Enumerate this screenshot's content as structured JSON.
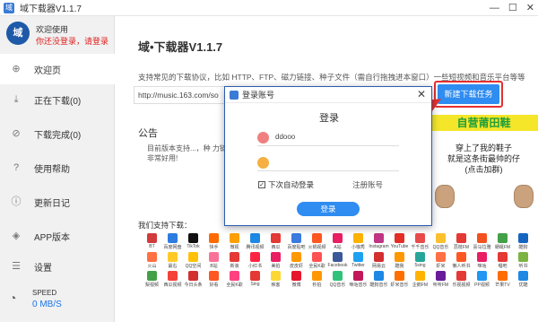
{
  "window": {
    "title": "域下载器V1.1.7",
    "min": "—",
    "max": "☐",
    "close": "✕"
  },
  "user": {
    "avatar_text": "域",
    "name": "欢迎使用",
    "login_tip": "你还没登录，请登录"
  },
  "sidebar": {
    "items": [
      {
        "label": "欢迎页",
        "icon": "plus-circle-icon"
      },
      {
        "label": "正在下载(0)",
        "icon": "download-icon"
      },
      {
        "label": "下载完成(0)",
        "icon": "check-circle-icon"
      },
      {
        "label": "使用帮助",
        "icon": "help-icon"
      },
      {
        "label": "更新日记",
        "icon": "info-icon"
      },
      {
        "label": "APP版本",
        "icon": "cube-icon"
      },
      {
        "label": "设置",
        "icon": "settings-icon"
      }
    ],
    "speed": {
      "label": "SPEED",
      "value": "0 MB/S"
    }
  },
  "main": {
    "title": "域•下载器V1.1.7",
    "subtitle": "支持常见的下载协议，比如 HTTP、FTP、磁力链接、种子文件（需自行拖拽进本窗口）一些短视频和音乐平台等等",
    "url_value": "http://music.163.com/so",
    "new_task_label": "新建下载任务",
    "notice_title": "公告",
    "notice_text": "目前版本支持...，种\n力链。非常好用!",
    "support_title": "我们支持下载："
  },
  "ad": {
    "banner": "自营莆田鞋",
    "line1": "穿上了我的鞋子",
    "line2": "就是这条街最帅的仔",
    "line3": "(点击加群)"
  },
  "apps": [
    {
      "name": "BT",
      "color": "#d23b3b"
    },
    {
      "name": "百度网盘",
      "color": "#2d7de0"
    },
    {
      "name": "TikTok",
      "color": "#111111"
    },
    {
      "name": "快手",
      "color": "#ff6a00"
    },
    {
      "name": "微视",
      "color": "#ff9f00"
    },
    {
      "name": "腾讯视频",
      "color": "#1e88e5"
    },
    {
      "name": "西瓜",
      "color": "#e53935"
    },
    {
      "name": "百度贴吧",
      "color": "#3b7be0"
    },
    {
      "name": "火锅视频",
      "color": "#ff5722"
    },
    {
      "name": "A站",
      "color": "#e91e63"
    },
    {
      "name": "小咖秀",
      "color": "#ffb300"
    },
    {
      "name": "Instagram",
      "color": "#c13584"
    },
    {
      "name": "YouTube",
      "color": "#e52d27"
    },
    {
      "name": "千千音乐",
      "color": "#e94b4b"
    },
    {
      "name": "QQ音乐",
      "color": "#fbc02d"
    },
    {
      "name": "荔枝FM",
      "color": "#e53935"
    },
    {
      "name": "喜马拉雅",
      "color": "#f4511e"
    },
    {
      "name": "蜻蜓FM",
      "color": "#43a047"
    },
    {
      "name": "酷狗",
      "color": "#1565c0"
    },
    {
      "name": "火山",
      "color": "#ff7043"
    },
    {
      "name": "最右",
      "color": "#ffca28"
    },
    {
      "name": "QQ空间",
      "color": "#ffc107"
    },
    {
      "name": "B站",
      "color": "#fb7299"
    },
    {
      "name": "新浪",
      "color": "#e53935"
    },
    {
      "name": "小红书",
      "color": "#ff2442"
    },
    {
      "name": "美拍",
      "color": "#e91e63"
    },
    {
      "name": "皮皮虾",
      "color": "#ff9800"
    },
    {
      "name": "全民K歌",
      "color": "#ff5252"
    },
    {
      "name": "Facebook",
      "color": "#3b5998"
    },
    {
      "name": "Twitter",
      "color": "#1da1f2"
    },
    {
      "name": "网易云",
      "color": "#d32f2f"
    },
    {
      "name": "酷我",
      "color": "#ff9800"
    },
    {
      "name": "5sing",
      "color": "#26a69a"
    },
    {
      "name": "虾米",
      "color": "#ff7043"
    },
    {
      "name": "懒人听书",
      "color": "#ff5722"
    },
    {
      "name": "咪咕",
      "color": "#e91e63"
    },
    {
      "name": "唱吧",
      "color": "#e53935"
    },
    {
      "name": "听书",
      "color": "#7cb342"
    },
    {
      "name": "梨视频",
      "color": "#43a047"
    },
    {
      "name": "西瓜视频",
      "color": "#f44336"
    },
    {
      "name": "今日头条",
      "color": "#d32f2f"
    },
    {
      "name": "好看",
      "color": "#ff5722"
    },
    {
      "name": "全民K歌",
      "color": "#ff4081"
    },
    {
      "name": "Sing",
      "color": "#e53935"
    },
    {
      "name": "映客",
      "color": "#fdd835"
    },
    {
      "name": "微博",
      "color": "#e6162d"
    },
    {
      "name": "秒拍",
      "color": "#ff9800"
    },
    {
      "name": "QQ音乐",
      "color": "#31c27c"
    },
    {
      "name": "咪咕音乐",
      "color": "#c2185b"
    },
    {
      "name": "酷狗音乐",
      "color": "#1e88e5"
    },
    {
      "name": "虾米音乐",
      "color": "#ff6f00"
    },
    {
      "name": "企鹅FM",
      "color": "#ffb300"
    },
    {
      "name": "听听FM",
      "color": "#6a1b9a"
    },
    {
      "name": "乐视视频",
      "color": "#e53935"
    },
    {
      "name": "PP视频",
      "color": "#2196f3"
    },
    {
      "name": "芒果TV",
      "color": "#ff6d00"
    },
    {
      "name": "优酷",
      "color": "#1e88e5"
    }
  ],
  "dialog": {
    "title": "登录账号",
    "close": "✕",
    "heading": "登录",
    "username": "ddooo",
    "password": "",
    "remember_label": "下次自动登录",
    "remember_checked": "✓",
    "register_label": "注册账号",
    "login_label": "登录"
  },
  "colors": {
    "accent": "#2f8cf0",
    "highlight": "#e53030",
    "login_tip": "#e02020"
  }
}
